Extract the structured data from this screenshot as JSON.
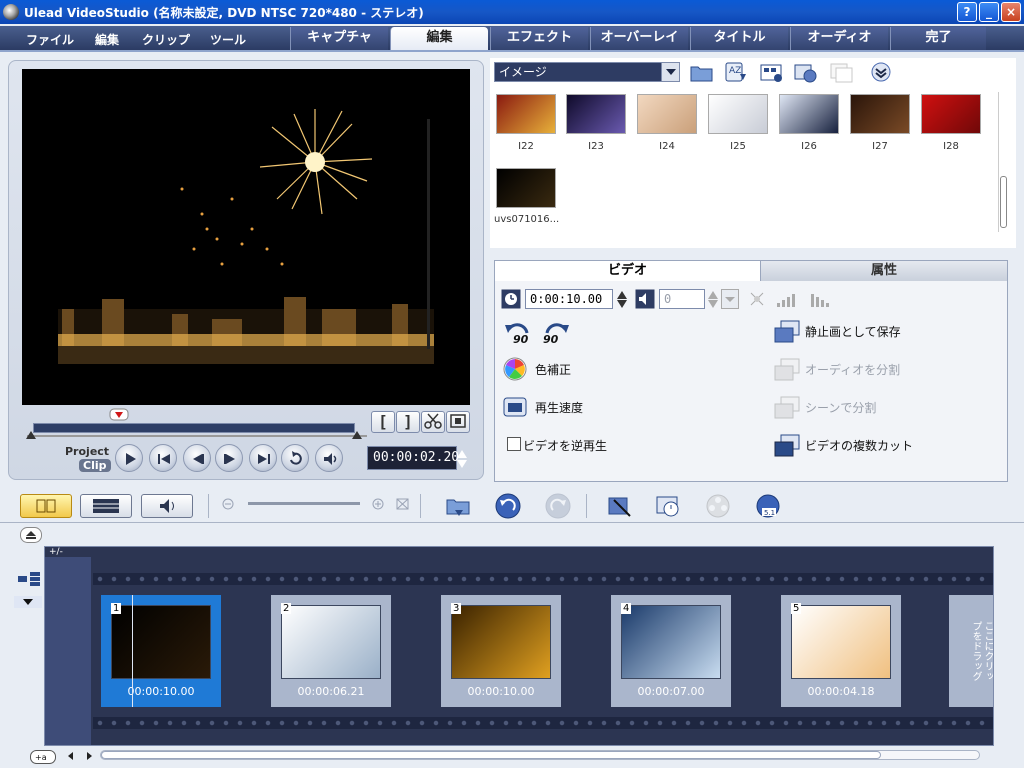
{
  "window": {
    "title": "Ulead VideoStudio (名称未設定, DVD NTSC 720*480 - ステレオ)",
    "help_label": "?",
    "minimize_label": "_",
    "maximize_label": "□",
    "close_label": "×"
  },
  "menu": {
    "items": [
      "ファイル",
      "編集",
      "クリップ",
      "ツール"
    ]
  },
  "steps": {
    "tabs": [
      "キャプチャ",
      "編集",
      "エフェクト",
      "オーバーレイ",
      "タイトル",
      "オーディオ",
      "完了"
    ],
    "active": "編集"
  },
  "preview": {
    "project_label": "Project",
    "clip_label": "Clip",
    "timecode": "00:00:02.20",
    "mark_in": "[",
    "mark_out": "]"
  },
  "library": {
    "category": "イメージ",
    "items": [
      {
        "label": "I22",
        "colors": [
          "#8a1a10",
          "#e8b13a"
        ]
      },
      {
        "label": "I23",
        "colors": [
          "#0f0a2a",
          "#6a5ab0"
        ]
      },
      {
        "label": "I24",
        "colors": [
          "#f2d8c0",
          "#caa07a"
        ]
      },
      {
        "label": "I25",
        "colors": [
          "#ffffff",
          "#c8ccd6"
        ]
      },
      {
        "label": "I26",
        "colors": [
          "#dfe6f4",
          "#17213e"
        ]
      },
      {
        "label": "I27",
        "colors": [
          "#2a150a",
          "#7a4a26"
        ]
      },
      {
        "label": "I28",
        "colors": [
          "#d01010",
          "#700808"
        ]
      },
      {
        "label": "uvs071016...",
        "colors": [
          "#000000",
          "#3a2a10"
        ]
      }
    ]
  },
  "options": {
    "tabs": [
      "ビデオ",
      "属性"
    ],
    "duration": "0:00:10.00",
    "volume": "0",
    "color_correction": "色補正",
    "playback_speed": "再生速度",
    "reverse_video": "ビデオを逆再生",
    "save_still": "静止画として保存",
    "split_audio": "オーディオを分割",
    "split_by_scene": "シーンで分割",
    "multi_trim": "ビデオの複数カット",
    "rotate_left_label": "90",
    "rotate_right_label": "90"
  },
  "storyboard": {
    "clips": [
      {
        "number": "1",
        "duration": "00:00:10.00",
        "colors": [
          "#000000",
          "#2a1a08"
        ]
      },
      {
        "number": "2",
        "duration": "00:00:06.21",
        "colors": [
          "#ffffff",
          "#9ab0c8"
        ]
      },
      {
        "number": "3",
        "duration": "00:00:10.00",
        "colors": [
          "#3a2200",
          "#e0a020"
        ]
      },
      {
        "number": "4",
        "duration": "00:00:07.00",
        "colors": [
          "#1a3a6a",
          "#c8dcf0"
        ]
      },
      {
        "number": "5",
        "duration": "00:00:04.18",
        "colors": [
          "#ffffff",
          "#f0c080"
        ]
      }
    ],
    "drop_hint": "ここにクリップをドラッグ",
    "track_menu_label": "+/-"
  },
  "theme": {
    "accent": "#1f7ad6",
    "title_bar": "#0b45b4",
    "panel": "#2c3552"
  }
}
